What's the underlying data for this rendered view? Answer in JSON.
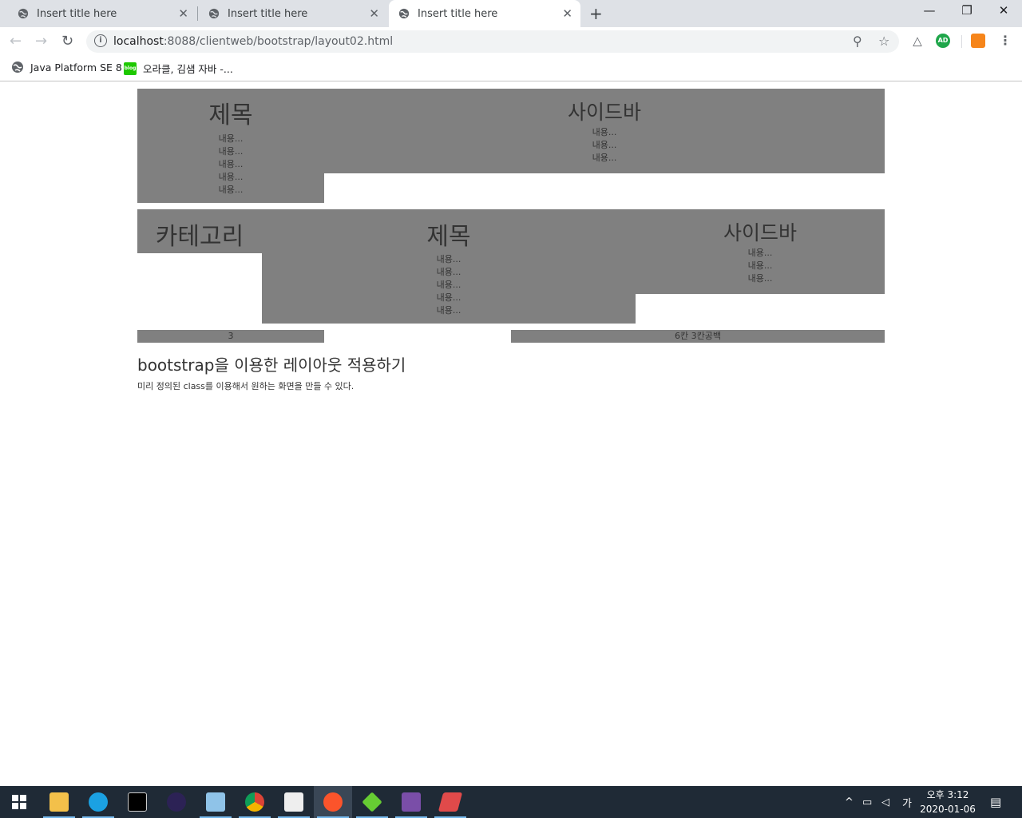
{
  "browser": {
    "tabs": [
      {
        "title": "Insert title here",
        "active": false
      },
      {
        "title": "Insert title here",
        "active": false
      },
      {
        "title": "Insert title here",
        "active": true
      }
    ],
    "url_host": "localhost",
    "url_rest": ":8088/clientweb/bootstrap/layout02.html",
    "bookmarks": [
      {
        "label": "Java Platform SE 8",
        "icon": "globe-icon"
      },
      {
        "label": "오라클, 김샘 자바 -...",
        "icon": "blog-icon"
      }
    ],
    "extensions": [
      {
        "name": "drive-icon",
        "text": ""
      },
      {
        "name": "adguard-icon",
        "text": "AD"
      },
      {
        "name": "metamask-icon",
        "text": ""
      }
    ]
  },
  "row1": {
    "left": {
      "title": "제목",
      "lines": [
        "내용...",
        "내용...",
        "내용...",
        "내용...",
        "내용..."
      ]
    },
    "right": {
      "title": "사이드바",
      "lines": [
        "내용...",
        "내용...",
        "내용..."
      ]
    }
  },
  "row2": {
    "left": {
      "title": "카테고리"
    },
    "middle": {
      "title": "제목",
      "lines": [
        "내용...",
        "내용...",
        "내용...",
        "내용...",
        "내용..."
      ]
    },
    "right": {
      "title": "사이드바",
      "lines": [
        "내용...",
        "내용...",
        "내용..."
      ]
    }
  },
  "row3": {
    "left": "3",
    "right": "6칸 3칸공백"
  },
  "content": {
    "heading": "bootstrap을 이용한 레이아웃 적용하기",
    "description": "미리 정의된 class를 이용해서 원하는 화면을 만들 수 있다."
  },
  "taskbar": {
    "apps": [
      "file-explorer-icon",
      "internet-explorer-icon",
      "terminal-icon",
      "eclipse-icon",
      "paint-icon",
      "chrome-icon",
      "typora-icon",
      "brave-icon",
      "sketchup-icon",
      "game-icon",
      "vanilla-icon"
    ],
    "tray_ime": "가",
    "clock_time": "오후 3:12",
    "clock_date": "2020-01-06"
  }
}
